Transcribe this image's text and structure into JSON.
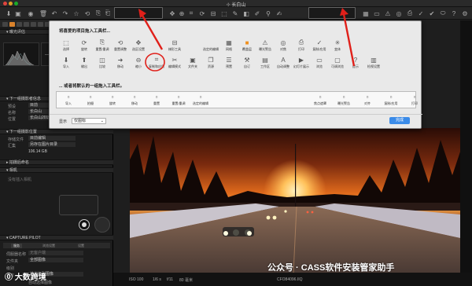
{
  "window": {
    "title": "长白山"
  },
  "dialog": {
    "heading1": "将喜爱的项目拖入工具栏...",
    "heading2": "... 或者将默认的一组拖入工具栏。",
    "row1": [
      {
        "icon": "select-icon",
        "label": "选择"
      },
      {
        "icon": "rotate-icon",
        "label": "旋转"
      },
      {
        "icon": "copy-icon",
        "label": "重置/重调"
      },
      {
        "icon": "reset-adjust-icon",
        "label": "重置调整"
      },
      {
        "icon": "pick-icon",
        "label": "选区设置"
      },
      {
        "icon": "",
        "label": ""
      },
      {
        "icon": "keystone-icon",
        "label": "梯形工具"
      },
      {
        "icon": "",
        "label": ""
      },
      {
        "icon": "",
        "label": "选定的编辑"
      },
      {
        "icon": "grid-icon",
        "label": "网格"
      },
      {
        "icon": "overlay-icon",
        "label": "覆盖层"
      },
      {
        "icon": "warning-icon",
        "label": "曝光警告"
      },
      {
        "icon": "focus-icon",
        "label": "对焦"
      },
      {
        "icon": "print-icon",
        "label": "打印"
      },
      {
        "icon": "copy-apply-icon",
        "label": "复制/应用"
      },
      {
        "icon": "toggle-icon",
        "label": "变体"
      }
    ],
    "row2": [
      {
        "icon": "import-icon",
        "label": "导入"
      },
      {
        "icon": "output-icon",
        "label": "输出"
      },
      {
        "icon": "compare-icon",
        "label": "比较"
      },
      {
        "icon": "move-icon",
        "label": "移动"
      },
      {
        "icon": "zoom-out-icon",
        "label": "缩小"
      },
      {
        "icon": "crop-icon",
        "label": "复制和应用"
      },
      {
        "icon": "edit-mode-icon",
        "label": "编辑模式"
      },
      {
        "icon": "folder-icon",
        "label": "文件夹"
      },
      {
        "icon": "stack-icon",
        "label": "资源"
      },
      {
        "icon": "preset-icon",
        "label": "预置"
      },
      {
        "icon": "custom-icon",
        "label": "自订"
      },
      {
        "icon": "workspace-icon",
        "label": "工作区"
      },
      {
        "icon": "auto-adjust-icon",
        "label": "自动调整"
      },
      {
        "icon": "slideshow-icon",
        "label": "幻灯片展示"
      },
      {
        "icon": "window-icon",
        "label": "浏览"
      },
      {
        "icon": "viewer-icon",
        "label": "可调浏览"
      },
      {
        "icon": "hint-icon",
        "label": "提示"
      },
      {
        "icon": "cache-icon",
        "label": "检视设置"
      }
    ],
    "strip": [
      {
        "label": "导入"
      },
      {
        "label": "拍摄"
      },
      {
        "label": "旋转"
      },
      {
        "label": "移动"
      },
      {
        "label": "重置"
      },
      {
        "label": "重置/重调"
      },
      {
        "label": "选定的编辑"
      },
      {
        "label": "焦点遮罩"
      },
      {
        "label": "曝光警告"
      },
      {
        "label": "对齐"
      },
      {
        "label": "复制/应用"
      },
      {
        "label": "打印"
      }
    ],
    "show_label": "显示",
    "show_value": "仅图标",
    "done": "完成"
  },
  "left": {
    "section_metadata": "下一组摄影者信息",
    "label_preset": "预设",
    "preset_value": "目前",
    "label_name": "名称",
    "name_value": "长白山",
    "label_location": "位置",
    "location_value": "长白山2015",
    "section_next": "下一组摄影位置",
    "label_store": "存储文件",
    "store_value": "目前编辑",
    "label_archive": "汇集",
    "archive_value": "另存在图片目录",
    "size_value": "106.14 GB",
    "section_naming": "拍摄后命名",
    "section_camera": "相机",
    "camera_hint": "没有插入相机",
    "section_pilot": "CAPTURE PILOT",
    "pilot_tabs": [
      "服务",
      "浏览设置",
      "设置"
    ],
    "label_server": "伺服器名称",
    "server_value": "无客户端",
    "label_file": "文件夹",
    "file_value": "全部图像",
    "label_rating": "级别",
    "label_publish": "发布",
    "publish_value": "选定级别图像",
    "auto_label": "自动选择图像"
  },
  "viewer": {
    "iso": "ISO 100",
    "shutter": "1/6 s",
    "aperture": "f/11",
    "focal": "80 毫米",
    "filename": "CFO84096.IIQ"
  },
  "watermarks": {
    "left": "大数跨境",
    "right": "公众号 · CASS软件安装管家助手"
  }
}
